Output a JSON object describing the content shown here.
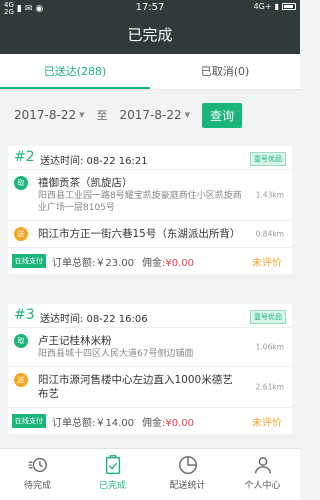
{
  "status_bar": {
    "carrier_top": "4G",
    "carrier_bottom": "2G",
    "time": "17:57",
    "network_right": "4G+"
  },
  "header": {
    "title": "已完成"
  },
  "tabs": [
    {
      "label": "已送达(288)",
      "active": true
    },
    {
      "label": "已取消(0)",
      "active": false
    }
  ],
  "date_filter": {
    "start": "2017-8-22",
    "separator": "至",
    "end": "2017-8-22",
    "query_label": "查询"
  },
  "orders": [
    {
      "number": "#2",
      "send_time": "送达时间: 08-22 16:21",
      "badge": "壹号优品",
      "pickup": {
        "icon_label": "取",
        "name": "禧御贡茶（凯旋店）",
        "address": "阳西县工业园一路8号耀宝凯旋豪庭商住小区凯旋商业广场一层8105号",
        "distance": "1.43km"
      },
      "dropoff": {
        "icon_label": "送",
        "name": "阳江市方正一街六巷15号（东湖派出所背）",
        "distance": "0.84km"
      },
      "pay_label": "在线支付",
      "total": "订单总额:￥23.00",
      "commission_label": "佣金:",
      "commission_value": "¥0.00",
      "rating": "未评价"
    },
    {
      "number": "#3",
      "send_time": "送达时间: 08-22 16:06",
      "badge": "壹号优品",
      "pickup": {
        "icon_label": "取",
        "name": "卢王记桂林米粉",
        "address": "阳西县城十四区人民大道67号侧边铺面",
        "distance": "1.06km"
      },
      "dropoff": {
        "icon_label": "送",
        "name": "阳江市源河售楼中心左边直入1000米德艺布艺",
        "distance": "2.61km"
      },
      "pay_label": "在线支付",
      "total": "订单总额:￥14.00",
      "commission_label": "佣金:",
      "commission_value": "¥0.00",
      "rating": "未评价"
    }
  ],
  "bottom_nav": [
    {
      "label": "待完成",
      "icon": "clock-list-icon",
      "active": false
    },
    {
      "label": "已完成",
      "icon": "check-clipboard-icon",
      "active": true
    },
    {
      "label": "配送统计",
      "icon": "pie-chart-icon",
      "active": false
    },
    {
      "label": "个人中心",
      "icon": "person-icon",
      "active": false
    }
  ],
  "colors": {
    "primary": "#1ab578",
    "header_bg": "#2f3a3c",
    "warning": "#f5a623",
    "price_red": "#e8434b"
  }
}
